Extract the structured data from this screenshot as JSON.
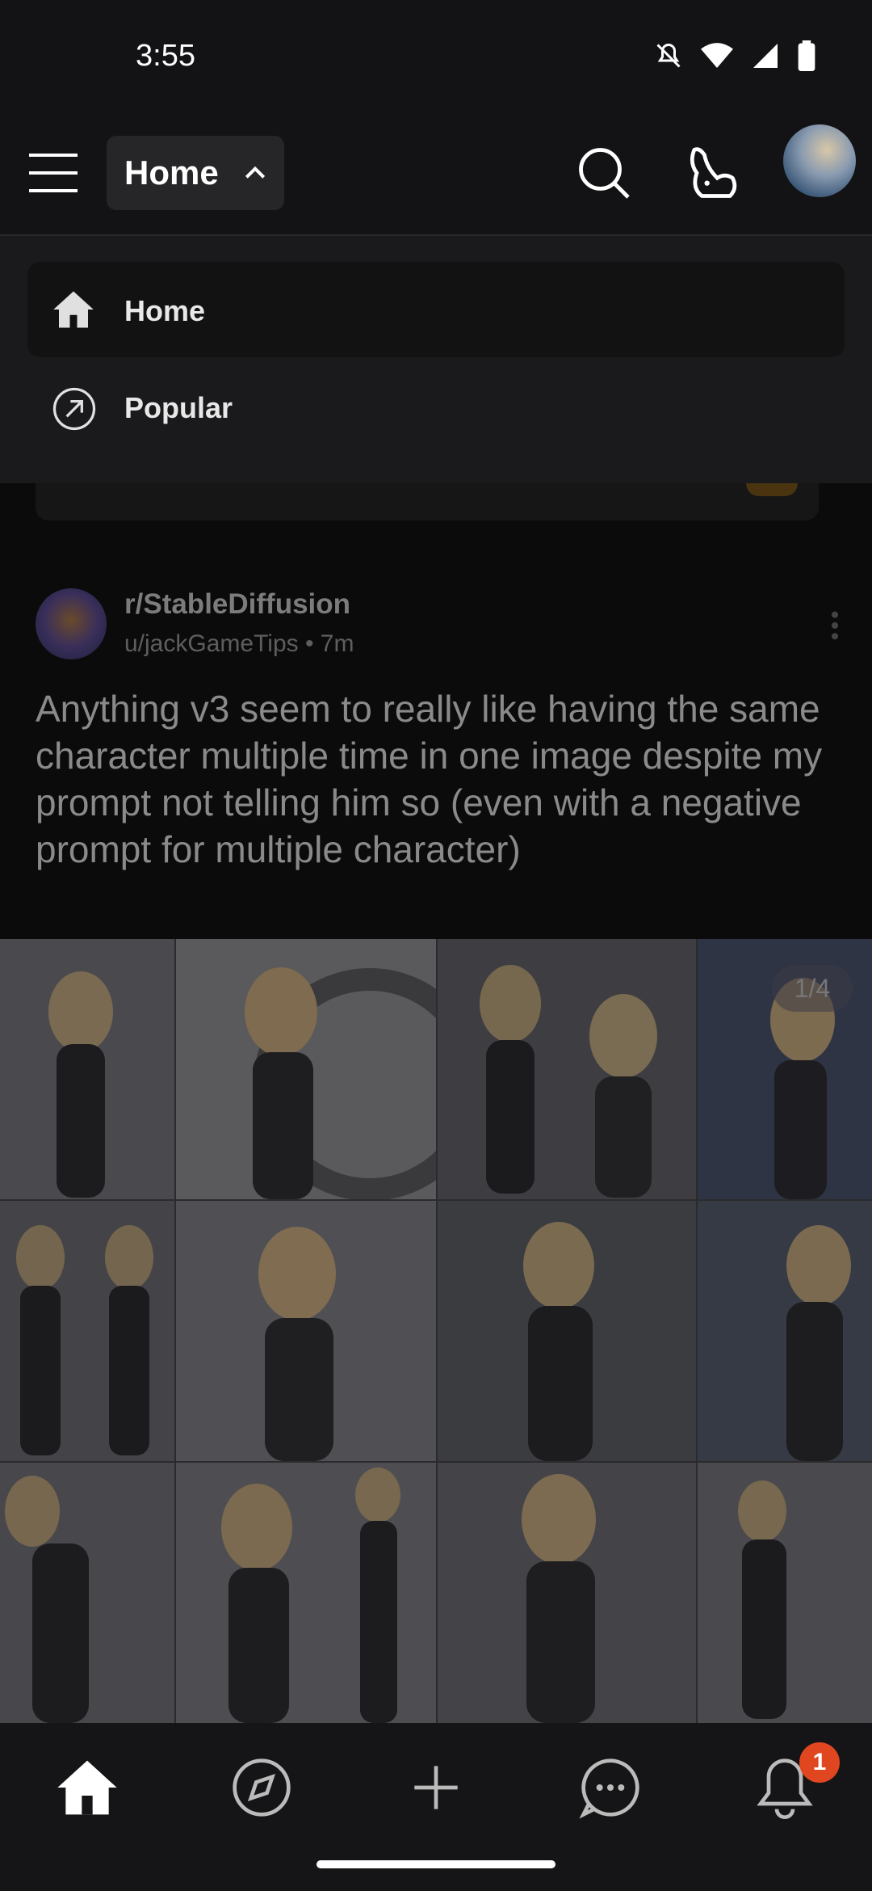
{
  "status_bar": {
    "time": "3:55"
  },
  "header": {
    "feed_label": "Home"
  },
  "dropdown": {
    "items": [
      {
        "label": "Home",
        "icon": "home-icon"
      },
      {
        "label": "Popular",
        "icon": "popular-arrow-icon"
      }
    ]
  },
  "post": {
    "subreddit": "r/StableDiffusion",
    "meta": "u/jackGameTips • 7m",
    "title": "Anything v3 seem to really like having the same character multiple time in one image despite my prompt not telling him so (even with a negative prompt for multiple character)",
    "gallery_counter": "1/4"
  },
  "bottom_nav": {
    "items": [
      "home-icon",
      "compass-icon",
      "plus-icon",
      "chat-icon",
      "bell-icon"
    ],
    "notification_count": "1"
  },
  "colors": {
    "background": "#0b0b0b",
    "badge": "#e0461f",
    "chip": "#262628"
  }
}
